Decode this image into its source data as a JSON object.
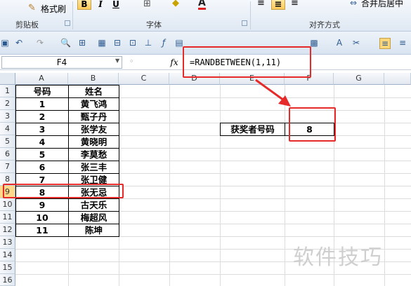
{
  "ribbon": {
    "clipboard": {
      "format_painter": "格式刷",
      "group_label": "剪贴板"
    },
    "font": {
      "group_label": "字体",
      "bold": "B",
      "italic": "I",
      "underline": "U",
      "font_color_letter": "A"
    },
    "alignment": {
      "group_label": "对齐方式",
      "merge_center": "合并后居中"
    }
  },
  "formula_bar": {
    "name_box": "F4",
    "fx_label": "fx",
    "formula": "=RANDBETWEEN(1,11)"
  },
  "sheet": {
    "columns": [
      "A",
      "B",
      "C",
      "D",
      "E",
      "F",
      "G"
    ],
    "rows": [
      "1",
      "2",
      "3",
      "4",
      "5",
      "6",
      "7",
      "8",
      "9",
      "10",
      "11",
      "12",
      "13",
      "14",
      "15",
      "16"
    ],
    "table_header": {
      "number": "号码",
      "name": "姓名"
    },
    "table_rows": [
      {
        "number": "1",
        "name": "黄飞鸿"
      },
      {
        "number": "2",
        "name": "甄子丹"
      },
      {
        "number": "3",
        "name": "张学友"
      },
      {
        "number": "4",
        "name": "黄晓明"
      },
      {
        "number": "5",
        "name": "李莫愁"
      },
      {
        "number": "6",
        "name": "张三丰"
      },
      {
        "number": "7",
        "name": "张卫健"
      },
      {
        "number": "8",
        "name": "张无忌"
      },
      {
        "number": "9",
        "name": "古天乐"
      },
      {
        "number": "10",
        "name": "梅超风"
      },
      {
        "number": "11",
        "name": "陈坤"
      }
    ],
    "winner_label": "获奖者号码",
    "winner_value": "8",
    "selected_row": "9"
  },
  "watermark": "软件技巧",
  "colors": {
    "highlight": "#e62a2a",
    "selected_header": "#ffd98a"
  }
}
